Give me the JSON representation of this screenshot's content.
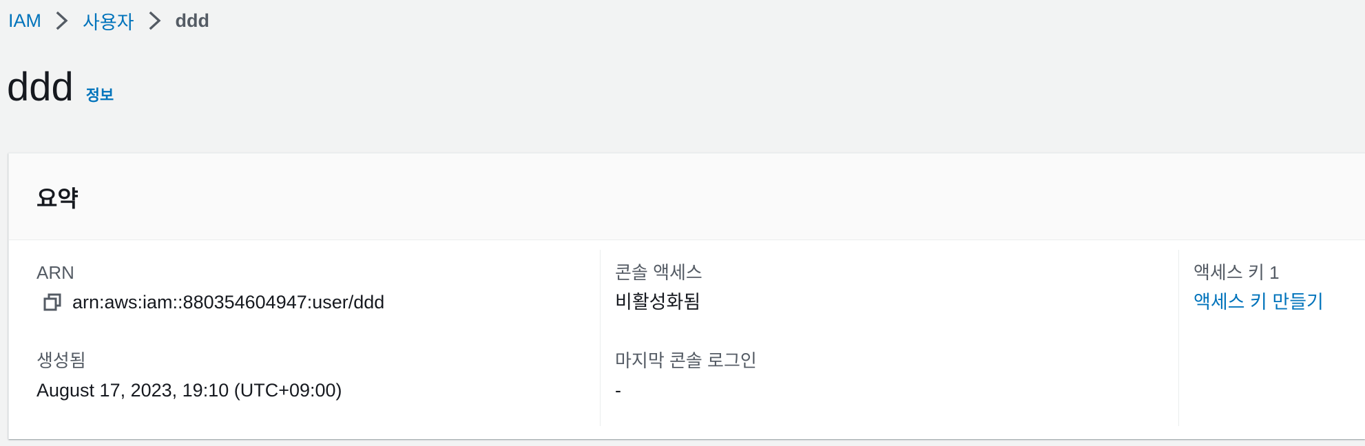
{
  "breadcrumb": {
    "items": [
      {
        "label": "IAM"
      },
      {
        "label": "사용자"
      }
    ],
    "current": "ddd"
  },
  "page": {
    "title": "ddd",
    "info_link": "정보"
  },
  "summary": {
    "title": "요약",
    "arn": {
      "label": "ARN",
      "value": "arn:aws:iam::880354604947:user/ddd",
      "copy_icon": "copy-icon"
    },
    "created": {
      "label": "생성됨",
      "value": "August 17, 2023, 19:10 (UTC+09:00)"
    },
    "console_access": {
      "label": "콘솔 액세스",
      "value": "비활성화됨"
    },
    "last_console_login": {
      "label": "마지막 콘솔 로그인",
      "value": "-"
    },
    "access_key_1": {
      "label": "액세스 키 1",
      "link": "액세스 키 만들기"
    }
  },
  "colors": {
    "link": "#0073bb",
    "label": "#545b64",
    "text": "#16191f",
    "background": "#f2f3f3"
  }
}
